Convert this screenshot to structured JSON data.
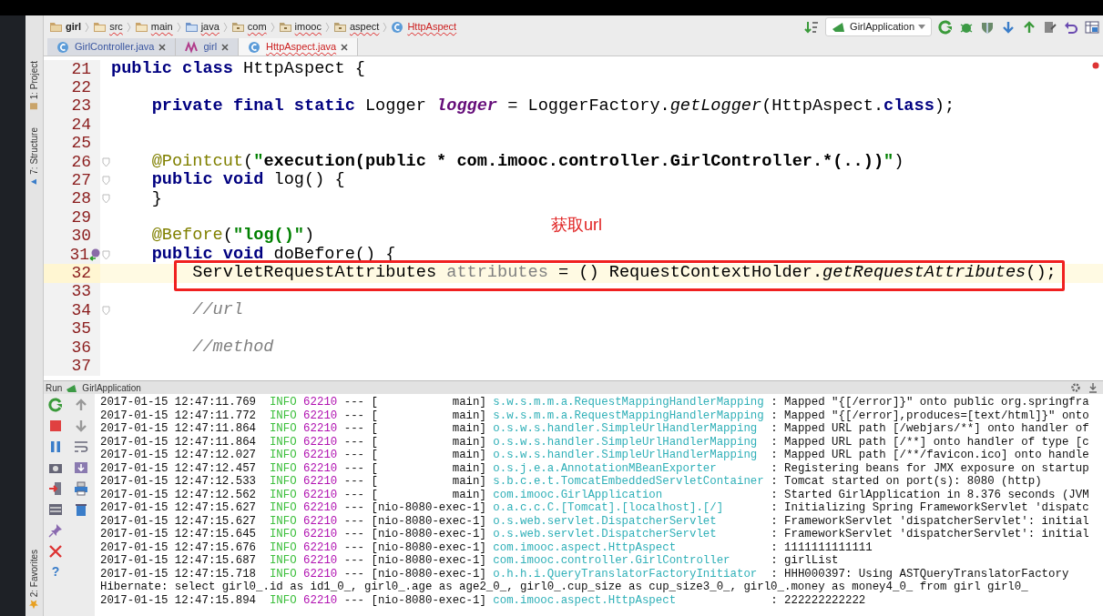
{
  "breadcrumb": [
    {
      "label": "girl",
      "kind": "module",
      "error": false
    },
    {
      "label": "src",
      "kind": "folder",
      "error": true
    },
    {
      "label": "main",
      "kind": "folder",
      "error": true
    },
    {
      "label": "java",
      "kind": "source",
      "error": true
    },
    {
      "label": "com",
      "kind": "package",
      "error": true
    },
    {
      "label": "imooc",
      "kind": "package",
      "error": true
    },
    {
      "label": "aspect",
      "kind": "package",
      "error": true
    },
    {
      "label": "HttpAspect",
      "kind": "class",
      "error": true
    }
  ],
  "toolbar": {
    "run_config": "GirlApplication"
  },
  "tabs": [
    {
      "label": "GirlController.java",
      "kind": "class",
      "selected": false,
      "error": false
    },
    {
      "label": "girl",
      "kind": "maven",
      "selected": false,
      "error": false
    },
    {
      "label": "HttpAspect.java",
      "kind": "class",
      "selected": true,
      "error": true
    }
  ],
  "left_tools_top": [
    {
      "label": "1: Project"
    },
    {
      "label": "7: Structure"
    }
  ],
  "left_tools_bottom": [
    {
      "label": "2: Favorites"
    }
  ],
  "editor": {
    "overlay_note": "获取url",
    "lines": [
      {
        "number": "21",
        "current": false,
        "boxed": false,
        "tokens": [
          {
            "text": "public class ",
            "kind": "kw"
          },
          {
            "text": "HttpAspect {",
            "kind": "text"
          }
        ]
      },
      {
        "number": "22",
        "current": false,
        "boxed": false
      },
      {
        "number": "23",
        "current": false,
        "boxed": false,
        "tokens": [
          {
            "text": "    private final static ",
            "kind": "kw"
          },
          {
            "text": "Logger ",
            "kind": "text"
          },
          {
            "text": "logger",
            "kind": "field"
          },
          {
            "text": " = LoggerFactory.",
            "kind": "text"
          },
          {
            "text": "getLogger",
            "kind": "static"
          },
          {
            "text": "(HttpAspect.",
            "kind": "text"
          },
          {
            "text": "class",
            "kind": "kw"
          },
          {
            "text": ");",
            "kind": "text"
          }
        ]
      },
      {
        "number": "24",
        "current": false,
        "boxed": false
      },
      {
        "number": "25",
        "current": false,
        "boxed": false
      },
      {
        "number": "26",
        "current": false,
        "boxed": false,
        "fold": true,
        "tokens": [
          {
            "text": "    @Pointcut",
            "kind": "annot"
          },
          {
            "text": "(",
            "kind": "text"
          },
          {
            "text": "\"",
            "kind": "str"
          },
          {
            "text": "execution(public * com.imooc.controller.GirlController.*(..))",
            "kind": "injected"
          },
          {
            "text": "\"",
            "kind": "str"
          },
          {
            "text": ")",
            "kind": "text"
          }
        ]
      },
      {
        "number": "27",
        "current": false,
        "boxed": false,
        "fold": true,
        "tokens": [
          {
            "text": "    public void ",
            "kind": "kw"
          },
          {
            "text": "log() {",
            "kind": "text"
          }
        ]
      },
      {
        "number": "28",
        "current": false,
        "boxed": false,
        "fold": true,
        "tokens": [
          {
            "text": "    }",
            "kind": "text"
          }
        ]
      },
      {
        "number": "29",
        "current": false,
        "boxed": false
      },
      {
        "number": "30",
        "current": false,
        "boxed": false,
        "tokens": [
          {
            "text": "    @Before",
            "kind": "annot"
          },
          {
            "text": "(",
            "kind": "text"
          },
          {
            "text": "\"log()\"",
            "kind": "str"
          },
          {
            "text": ")",
            "kind": "text"
          }
        ]
      },
      {
        "number": "31",
        "current": false,
        "boxed": false,
        "fold": true,
        "gutter_icon": true,
        "tokens": [
          {
            "text": "    public void ",
            "kind": "kw"
          },
          {
            "text": "doBefore() {",
            "kind": "text"
          }
        ]
      },
      {
        "number": "32",
        "current": true,
        "boxed": true,
        "tokens": [
          {
            "text": "        ServletRequestAttributes ",
            "kind": "text"
          },
          {
            "text": "attributes",
            "kind": "unused"
          },
          {
            "text": " = () RequestContextHolder.",
            "kind": "text"
          },
          {
            "text": "getRequestAttributes",
            "kind": "static"
          },
          {
            "text": "();",
            "kind": "text"
          }
        ]
      },
      {
        "number": "33",
        "current": false,
        "boxed": false
      },
      {
        "number": "34",
        "current": false,
        "boxed": false,
        "fold": true,
        "tokens": [
          {
            "text": "        //url",
            "kind": "comment"
          }
        ]
      },
      {
        "number": "35",
        "current": false,
        "boxed": false
      },
      {
        "number": "36",
        "current": false,
        "boxed": false,
        "tokens": [
          {
            "text": "        //method",
            "kind": "comment"
          }
        ]
      },
      {
        "number": "37",
        "current": false,
        "boxed": false
      }
    ]
  },
  "run_panel": {
    "title": "Run",
    "config": "GirlApplication",
    "help": "?",
    "rows": [
      {
        "kind": "log",
        "time": "2017-01-15 12:47:11.769",
        "level": "INFO",
        "pid": "62210",
        "sep": "---",
        "thread": "[           main]",
        "logger": "s.w.s.m.m.a.RequestMappingHandlerMapping",
        "message": ": Mapped \"{[/error]}\" onto public org.springfra"
      },
      {
        "kind": "log",
        "time": "2017-01-15 12:47:11.772",
        "level": "INFO",
        "pid": "62210",
        "sep": "---",
        "thread": "[           main]",
        "logger": "s.w.s.m.m.a.RequestMappingHandlerMapping",
        "message": ": Mapped \"{[/error],produces=[text/html]}\" onto"
      },
      {
        "kind": "log",
        "time": "2017-01-15 12:47:11.864",
        "level": "INFO",
        "pid": "62210",
        "sep": "---",
        "thread": "[           main]",
        "logger": "o.s.w.s.handler.SimpleUrlHandlerMapping",
        "message": ": Mapped URL path [/webjars/**] onto handler of"
      },
      {
        "kind": "log",
        "time": "2017-01-15 12:47:11.864",
        "level": "INFO",
        "pid": "62210",
        "sep": "---",
        "thread": "[           main]",
        "logger": "o.s.w.s.handler.SimpleUrlHandlerMapping",
        "message": ": Mapped URL path [/**] onto handler of type [c"
      },
      {
        "kind": "log",
        "time": "2017-01-15 12:47:12.027",
        "level": "INFO",
        "pid": "62210",
        "sep": "---",
        "thread": "[           main]",
        "logger": "o.s.w.s.handler.SimpleUrlHandlerMapping",
        "message": ": Mapped URL path [/**/favicon.ico] onto handle"
      },
      {
        "kind": "log",
        "time": "2017-01-15 12:47:12.457",
        "level": "INFO",
        "pid": "62210",
        "sep": "---",
        "thread": "[           main]",
        "logger": "o.s.j.e.a.AnnotationMBeanExporter",
        "message": ": Registering beans for JMX exposure on startup"
      },
      {
        "kind": "log",
        "time": "2017-01-15 12:47:12.533",
        "level": "INFO",
        "pid": "62210",
        "sep": "---",
        "thread": "[           main]",
        "logger": "s.b.c.e.t.TomcatEmbeddedServletContainer",
        "message": ": Tomcat started on port(s): 8080 (http)"
      },
      {
        "kind": "log",
        "time": "2017-01-15 12:47:12.562",
        "level": "INFO",
        "pid": "62210",
        "sep": "---",
        "thread": "[           main]",
        "logger": "com.imooc.GirlApplication",
        "message": ": Started GirlApplication in 8.376 seconds (JVM"
      },
      {
        "kind": "log",
        "time": "2017-01-15 12:47:15.627",
        "level": "INFO",
        "pid": "62210",
        "sep": "---",
        "thread": "[nio-8080-exec-1]",
        "logger": "o.a.c.c.C.[Tomcat].[localhost].[/]",
        "message": ": Initializing Spring FrameworkServlet 'dispatc"
      },
      {
        "kind": "log",
        "time": "2017-01-15 12:47:15.627",
        "level": "INFO",
        "pid": "62210",
        "sep": "---",
        "thread": "[nio-8080-exec-1]",
        "logger": "o.s.web.servlet.DispatcherServlet",
        "message": ": FrameworkServlet 'dispatcherServlet': initial"
      },
      {
        "kind": "log",
        "time": "2017-01-15 12:47:15.645",
        "level": "INFO",
        "pid": "62210",
        "sep": "---",
        "thread": "[nio-8080-exec-1]",
        "logger": "o.s.web.servlet.DispatcherServlet",
        "message": ": FrameworkServlet 'dispatcherServlet': initial"
      },
      {
        "kind": "log",
        "time": "2017-01-15 12:47:15.676",
        "level": "INFO",
        "pid": "62210",
        "sep": "---",
        "thread": "[nio-8080-exec-1]",
        "logger": "com.imooc.aspect.HttpAspect",
        "message": ": 1111111111111"
      },
      {
        "kind": "log",
        "time": "2017-01-15 12:47:15.687",
        "level": "INFO",
        "pid": "62210",
        "sep": "---",
        "thread": "[nio-8080-exec-1]",
        "logger": "com.imooc.controller.GirlController",
        "message": ": girlList"
      },
      {
        "kind": "log",
        "time": "2017-01-15 12:47:15.718",
        "level": "INFO",
        "pid": "62210",
        "sep": "---",
        "thread": "[nio-8080-exec-1]",
        "logger": "o.h.h.i.QueryTranslatorFactoryInitiator",
        "message": ": HHH000397: Using ASTQueryTranslatorFactory"
      },
      {
        "kind": "plain",
        "text": "Hibernate: select girl0_.id as id1_0_, girl0_.age as age2_0_, girl0_.cup_size as cup_size3_0_, girl0_.money as money4_0_ from girl girl0_"
      },
      {
        "kind": "log",
        "time": "2017-01-15 12:47:15.894",
        "level": "INFO",
        "pid": "62210",
        "sep": "---",
        "thread": "[nio-8080-exec-1]",
        "logger": "com.imooc.aspect.HttpAspect",
        "message": ": 222222222222"
      }
    ]
  }
}
